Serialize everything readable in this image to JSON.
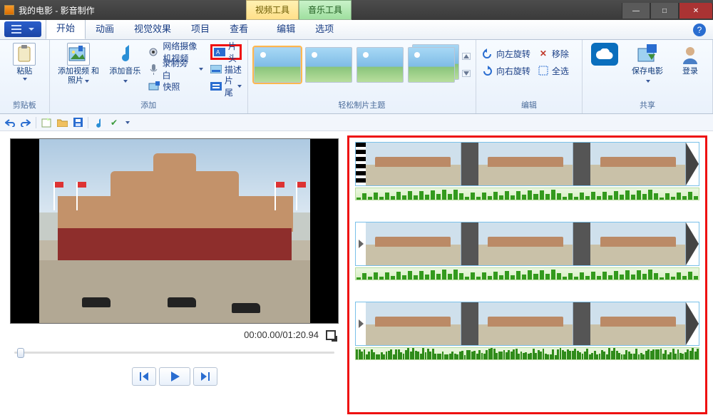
{
  "window": {
    "title": "我的电影 - 影音制作"
  },
  "context_tabs": {
    "video": "视频工具",
    "music": "音乐工具"
  },
  "win_controls": {
    "min": "—",
    "max": "□",
    "close": "✕"
  },
  "tabs": {
    "home": "开始",
    "animation": "动画",
    "visual": "视觉效果",
    "project": "项目",
    "view": "查看",
    "edit": "编辑",
    "options": "选项"
  },
  "groups": {
    "clipboard": "剪贴板",
    "add": "添加",
    "themes": "轻松制片主题",
    "edit": "编辑",
    "share": "共享"
  },
  "ribbon": {
    "paste": "粘贴",
    "add_video_photo": "添加视频\n和照片",
    "add_music": "添加音乐",
    "webcam_video": "网络摄像机视频",
    "record_narration": "录制旁白",
    "snapshot": "快照",
    "title": "片头",
    "caption": "描述",
    "credits": "片尾",
    "rotate_left": "向左旋转",
    "rotate_right": "向右旋转",
    "remove": "移除",
    "select_all": "全选",
    "save_movie": "保存电影",
    "sign_in": "登录"
  },
  "playback": {
    "time_current": "00:00.00",
    "time_total": "01:20.94",
    "time_sep": "/"
  },
  "help": "?"
}
